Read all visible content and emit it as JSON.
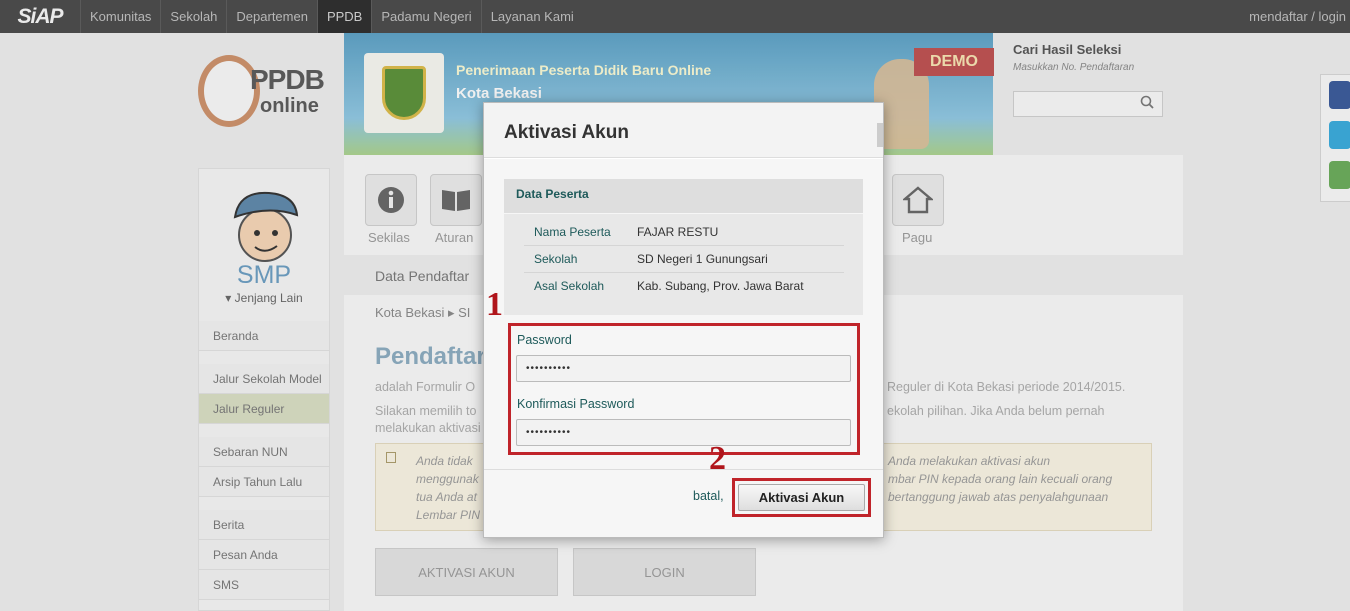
{
  "topbar": {
    "brand": "SiAP",
    "nav": [
      "Komunitas",
      "Sekolah",
      "Departemen",
      "PPDB",
      "Padamu Negeri",
      "Layanan Kami"
    ],
    "active_nav": "PPDB",
    "right": "mendaftar / login"
  },
  "logo": {
    "line1": "PPDB",
    "line2": "online"
  },
  "banner": {
    "title": "Penerimaan Peserta Didik Baru Online",
    "subtitle": "Kota Bekasi",
    "demo": "DEMO"
  },
  "search": {
    "title": "Cari Hasil Seleksi",
    "hint": "Masukkan No. Pendaftaran",
    "icon": "search-icon"
  },
  "sidebar": {
    "level": "SMP",
    "other_level": "Jenjang Lain",
    "items": [
      {
        "label": "Beranda"
      },
      {
        "label": "Jalur Sekolah Model"
      },
      {
        "label": "Jalur Reguler"
      },
      {
        "label": "Sebaran NUN"
      },
      {
        "label": "Arsip Tahun Lalu"
      },
      {
        "label": "Berita"
      },
      {
        "label": "Pesan Anda"
      },
      {
        "label": "SMS"
      }
    ]
  },
  "menu_icons": [
    {
      "label": "Sekilas",
      "icon": "info-icon"
    },
    {
      "label": "Aturan",
      "icon": "book-icon"
    },
    {
      "label": "Pagu",
      "icon": "home-icon"
    }
  ],
  "main": {
    "tab": "Data Pendaftar",
    "breadcrumb": "Kota Bekasi",
    "heading": "Pendaftar",
    "para1_start": "adalah Formulir O",
    "para1_end": "Reguler di Kota Bekasi periode 2014/2015.",
    "para2_start_a": "Silakan memilih to",
    "para2_start_b": "melakukan aktivasi",
    "para2_end": "ekolah pilihan. Jika Anda belum pernah",
    "notice_left": [
      "Anda tidak",
      "menggunak",
      "tua Anda at",
      "Lembar PIN"
    ],
    "notice_right": [
      "Anda melakukan aktivasi akun",
      "mbar PIN kepada orang lain kecuali orang",
      "bertanggung jawab atas penyalahgunaan"
    ],
    "btn_activate": "AKTIVASI AKUN",
    "btn_login": "LOGIN"
  },
  "modal": {
    "title": "Aktivasi Akun",
    "section": "Data Peserta",
    "rows": [
      {
        "key": "Nama Peserta",
        "value": "FAJAR RESTU"
      },
      {
        "key": "Sekolah",
        "value": "SD Negeri 1 Gunungsari"
      },
      {
        "key": "Asal Sekolah",
        "value": "Kab. Subang, Prov. Jawa Barat"
      }
    ],
    "password_label": "Password",
    "password_value": "••••••••••",
    "confirm_label": "Konfirmasi Password",
    "confirm_value": "••••••••••",
    "cancel": "batal,",
    "submit": "Aktivasi Akun"
  },
  "annotations": {
    "one": "1",
    "two": "2",
    "color": "#c0242a"
  }
}
